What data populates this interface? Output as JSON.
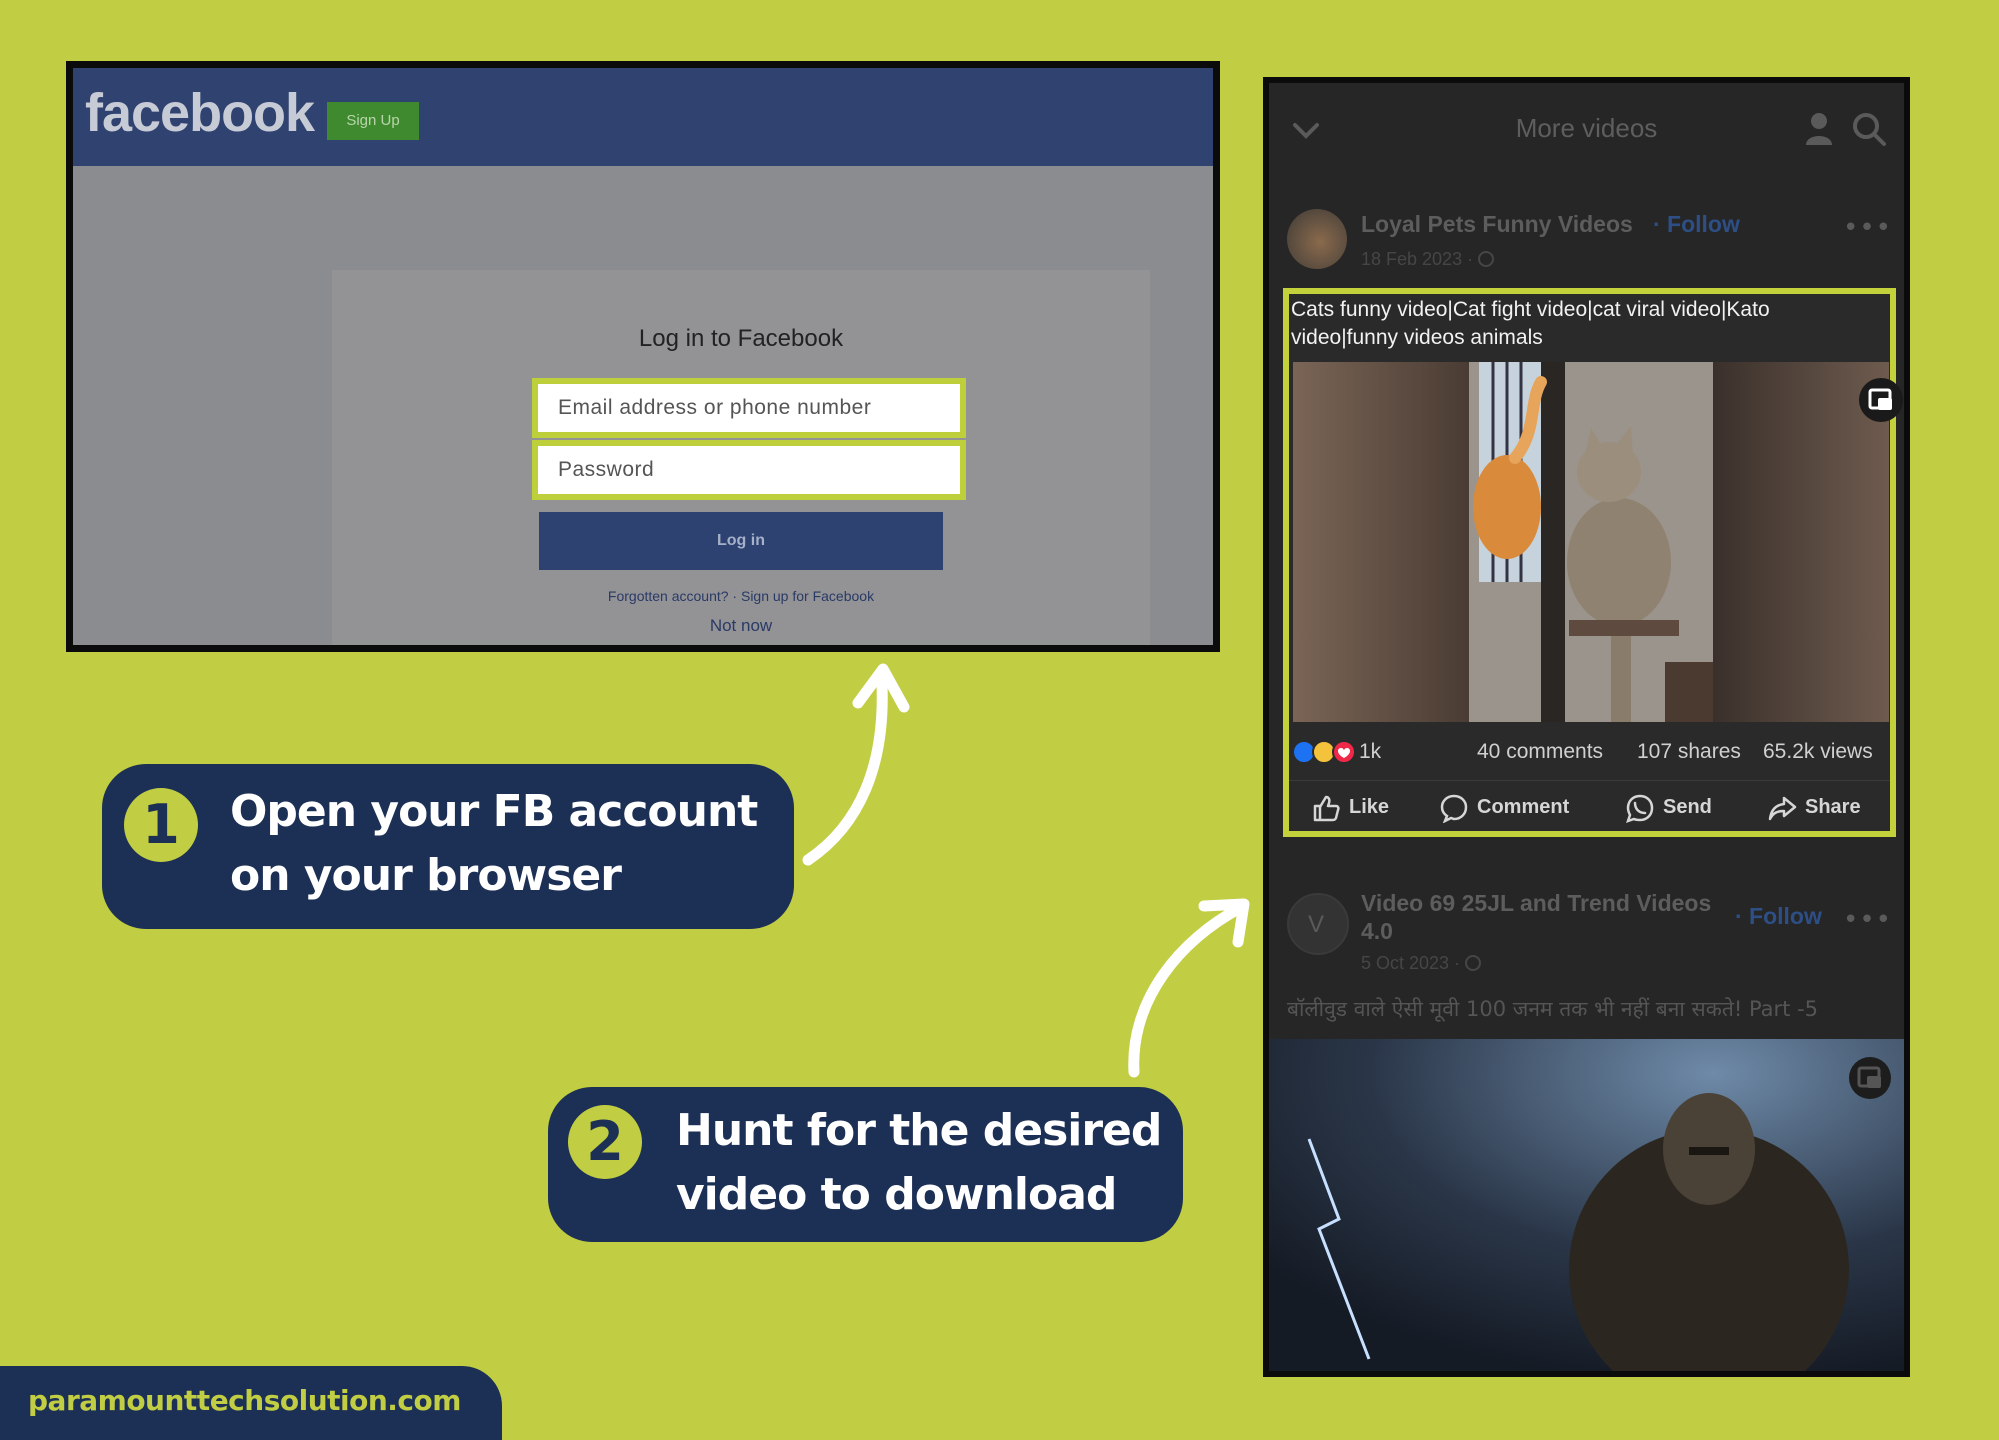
{
  "login_screen": {
    "logo_text": "facebook",
    "signup_label": "Sign Up",
    "title": "Log in to Facebook",
    "email_placeholder": "Email address or phone number",
    "password_placeholder": "Password",
    "login_button": "Log in",
    "links": "Forgotten account? · Sign up for Facebook",
    "not_now": "Not now"
  },
  "steps": [
    {
      "number": "1",
      "line1": "Open your FB account",
      "line2": "on your browser"
    },
    {
      "number": "2",
      "line1": "Hunt for the desired",
      "line2": "video to download"
    }
  ],
  "video_feed": {
    "header_title": "More videos",
    "icons": {
      "back": "chevron-down-icon",
      "profile": "person-icon",
      "search": "search-icon"
    },
    "post1": {
      "page_name": "Loyal Pets Funny Videos",
      "follow": "· Follow",
      "date": "18 Feb 2023 · ",
      "caption_line1": "Cats funny video|Cat fight video|cat viral video|Kato",
      "caption_line2": "video|funny videos animals",
      "reactions_count": "1k",
      "comments": "40 comments",
      "shares": "107 shares",
      "views": "65.2k views",
      "actions": {
        "like": "Like",
        "comment": "Comment",
        "send": "Send",
        "share": "Share"
      }
    },
    "post2": {
      "page_name_line1": "Video 69 25JL and Trend Videos",
      "page_name_line2": "4.0",
      "follow": "· Follow",
      "date": "5 Oct 2023 · ",
      "avatar_letter": "V",
      "caption": "बॉलीवुड वाले ऐसी मूवी 100 जनम तक भी नहीं बना सकते! Part -5"
    }
  },
  "brand": {
    "site": "paramounttechsolution.com"
  },
  "colors": {
    "background": "#c1cd42",
    "callout": "#1c2f55",
    "highlight": "#c3d13a",
    "fb_blue": "#2f4270"
  }
}
